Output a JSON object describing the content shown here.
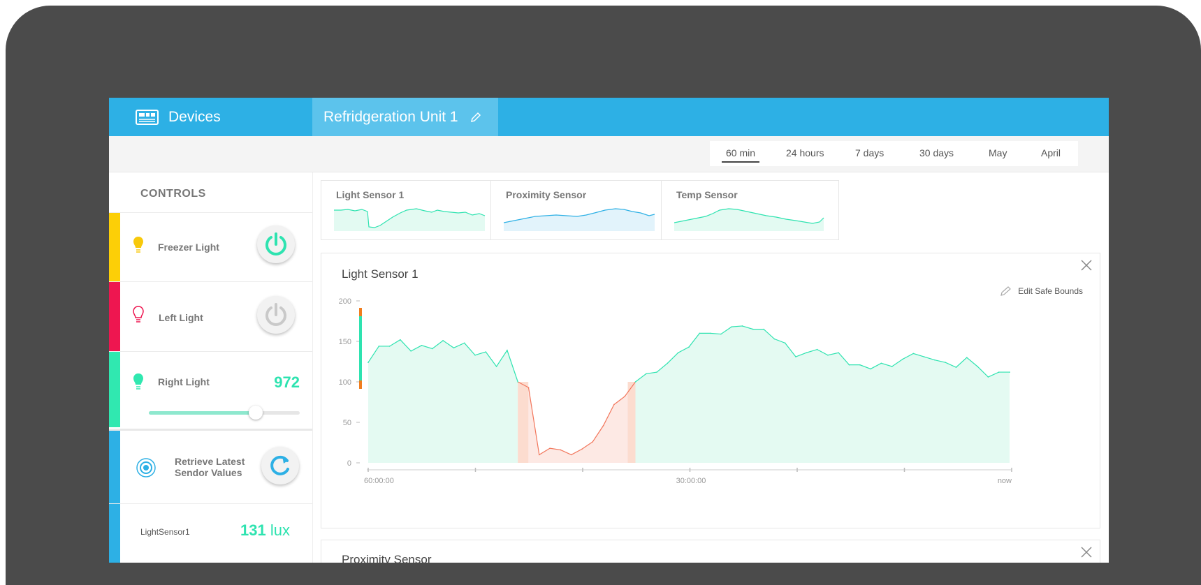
{
  "header": {
    "devices_label": "Devices",
    "device_icon": "device-board-icon",
    "unit_title": "Refridgeration Unit 1",
    "edit_icon": "pencil-icon"
  },
  "time_ranges": {
    "options": [
      "60 min",
      "24 hours",
      "7 days",
      "30 days",
      "May",
      "April"
    ],
    "selected": "60 min"
  },
  "sidebar": {
    "heading": "CONTROLS",
    "controls": [
      {
        "label": "Freezer Light",
        "stripe_color": "#fccf07",
        "bulb_color": "#f8c90b",
        "power_on": true
      },
      {
        "label": "Left Light",
        "stripe_color": "#ee1650",
        "bulb_color": "#ee1650",
        "power_on": false
      },
      {
        "label": "Right Light",
        "stripe_color": "#30e8b0",
        "bulb_color": "#30e8b0",
        "value": "972",
        "slider_fraction": 0.71
      },
      {
        "label": "Retrieve Latest Sendor Values",
        "stripe_color": "#2db0e5",
        "icon": "target-icon",
        "action_icon": "refresh-icon"
      }
    ],
    "readings": [
      {
        "sensor": "LightSensor1",
        "value": "131",
        "unit": "lux"
      }
    ]
  },
  "sparklines": [
    {
      "title": "Light Sensor 1",
      "color": "#2ee3b0"
    },
    {
      "title": "Proximity Sensor",
      "color": "#2db0e5"
    },
    {
      "title": "Temp Sensor",
      "color": "#2ee3b0"
    }
  ],
  "main_chart": {
    "title": "Light Sensor 1",
    "edit_bounds_label": "Edit Safe Bounds",
    "close_icon": "close-icon"
  },
  "second_chart": {
    "title": "Proximity Sensor",
    "close_icon": "close-icon"
  },
  "chart_data": {
    "type": "area",
    "title": "Light Sensor 1",
    "xlabel": "",
    "ylabel": "",
    "ylim": [
      0,
      200
    ],
    "y_ticks": [
      "200",
      "150",
      "100",
      "50",
      "0"
    ],
    "x_tick_labels": [
      "60:00:00",
      "30:00:00",
      "now"
    ],
    "safe_bounds": [
      100,
      200
    ],
    "colors": {
      "in_bounds": "#2ee3b0",
      "out_of_bounds": "#f2765b",
      "bound_marker": "#f07d1e"
    },
    "x": [
      0,
      1,
      2,
      3,
      4,
      5,
      6,
      7,
      8,
      9,
      10,
      11,
      12,
      13,
      14,
      15,
      16,
      17,
      18,
      19,
      20,
      21,
      22,
      23,
      24,
      25,
      26,
      27,
      28,
      29,
      30,
      31,
      32,
      33,
      34,
      35,
      36,
      37,
      38,
      39,
      40,
      41,
      42,
      43,
      44,
      45,
      46,
      47,
      48,
      49,
      50,
      51,
      52,
      53,
      54,
      55,
      56,
      57,
      58,
      59,
      60
    ],
    "values": [
      124,
      144,
      144,
      152,
      138,
      145,
      141,
      151,
      142,
      148,
      133,
      137,
      119,
      139,
      100,
      93,
      10,
      18,
      16,
      10,
      17,
      26,
      46,
      72,
      82,
      100,
      110,
      112,
      123,
      136,
      143,
      160,
      160,
      159,
      168,
      169,
      165,
      165,
      153,
      148,
      131,
      136,
      140,
      133,
      136,
      121,
      121,
      116,
      123,
      119,
      128,
      135,
      131,
      127,
      124,
      118,
      130,
      119,
      106,
      112,
      112
    ],
    "series_name": ""
  }
}
